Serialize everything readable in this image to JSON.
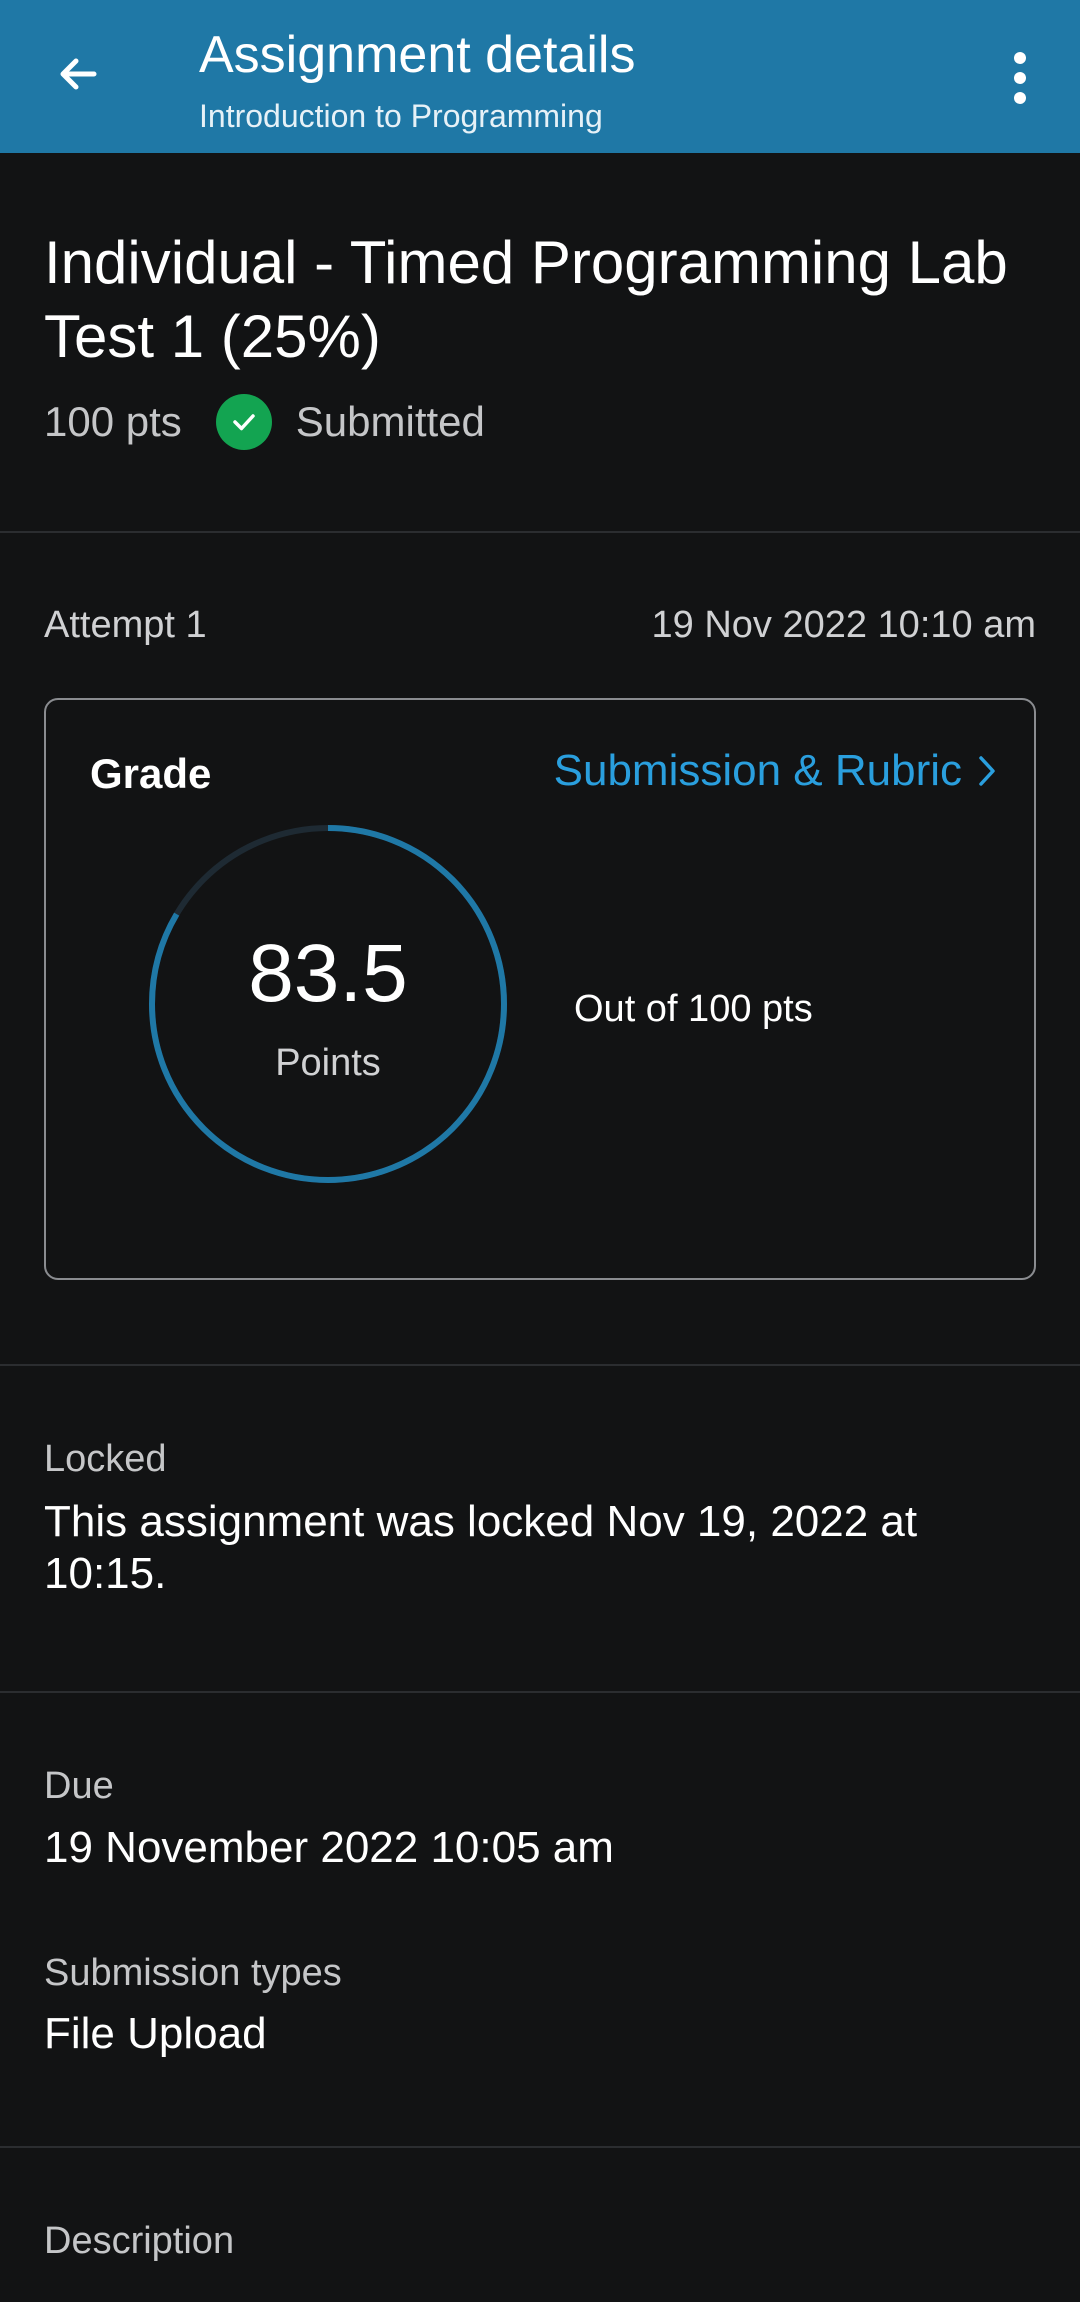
{
  "app_bar": {
    "title": "Assignment details",
    "subtitle": "Introduction to Programming",
    "back_icon": "arrow-left-icon",
    "menu_icon": "more-vertical-icon",
    "color": "#1f78a6"
  },
  "assignment": {
    "title": "Individual - Timed Programming Lab Test 1 (25%)",
    "points": "100 pts",
    "status": "Submitted",
    "status_icon": "check-circle-icon",
    "status_color": "#13a451"
  },
  "attempt": {
    "label": "Attempt 1",
    "date": "19 Nov 2022 10:10 am"
  },
  "grade": {
    "label": "Grade",
    "link_label": "Submission & Rubric",
    "link_icon": "chevron-right-icon",
    "link_color": "#2a9fde",
    "score": "83.5",
    "score_unit": "Points",
    "score_fraction": 0.835,
    "out_of": "Out of 100 pts"
  },
  "locked": {
    "label": "Locked",
    "text": "This assignment was locked Nov 19, 2022 at 10:15."
  },
  "due": {
    "label": "Due",
    "value": "19 November 2022 10:05 am"
  },
  "submission_types": {
    "label": "Submission types",
    "value": "File Upload"
  },
  "description": {
    "label": "Description"
  }
}
